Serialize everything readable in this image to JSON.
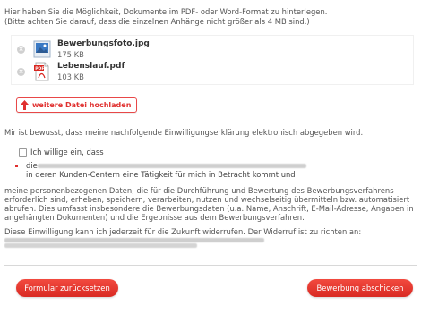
{
  "intro": {
    "line1": "Hier haben Sie die Möglichkeit, Dokumente im PDF- oder Word-Format zu hinterlegen.",
    "line2": "(Bitte achten Sie darauf, dass die einzelnen Anhänge nicht größer als 4 MB sind.)"
  },
  "files": [
    {
      "name": "Bewerbungsfoto.jpg",
      "size": "175 KB",
      "icon": "image-file-icon"
    },
    {
      "name": "Lebenslauf.pdf",
      "size": "103 KB",
      "icon": "pdf-file-icon"
    }
  ],
  "upload": {
    "label": "weitere Datei hochladen",
    "icon": "upload-arrow-icon"
  },
  "consent": {
    "intro": "Mir ist bewusst, dass meine nachfolgende Einwilligungserklärung elektronisch abgegeben wird.",
    "checkbox_label": "Ich willige ein, dass",
    "die": "die",
    "kunden": "in deren Kunden-Centern eine Tätigkeit für mich in Betracht kommt und",
    "body_line1": "meine personenbezogenen Daten, die für die Durchführung und Bewertung des Bewerbungsverfahrens",
    "body_line2": "erforderlich sind, erheben, speichern, verarbeiten, nutzen und wechselseitig übermitteln bzw. automatisiert",
    "body_line3": "abrufen. Dies umfasst insbesondere die Bewerbungsdaten (u.a. Name, Anschrift, E-Mail-Adresse, Angaben in",
    "body_line4": "angehängten Dokumenten) und die Ergebnisse aus dem Bewerbungsverfahren.",
    "widerruf": "Diese Einwilligung kann ich jederzeit für die Zukunft widerrufen. Der Widerruf ist zu richten an:"
  },
  "buttons": {
    "reset": "Formular zurücksetzen",
    "submit": "Bewerbung abschicken"
  },
  "colors": {
    "accent": "#e0302f",
    "divider": "#d8d8d8"
  }
}
